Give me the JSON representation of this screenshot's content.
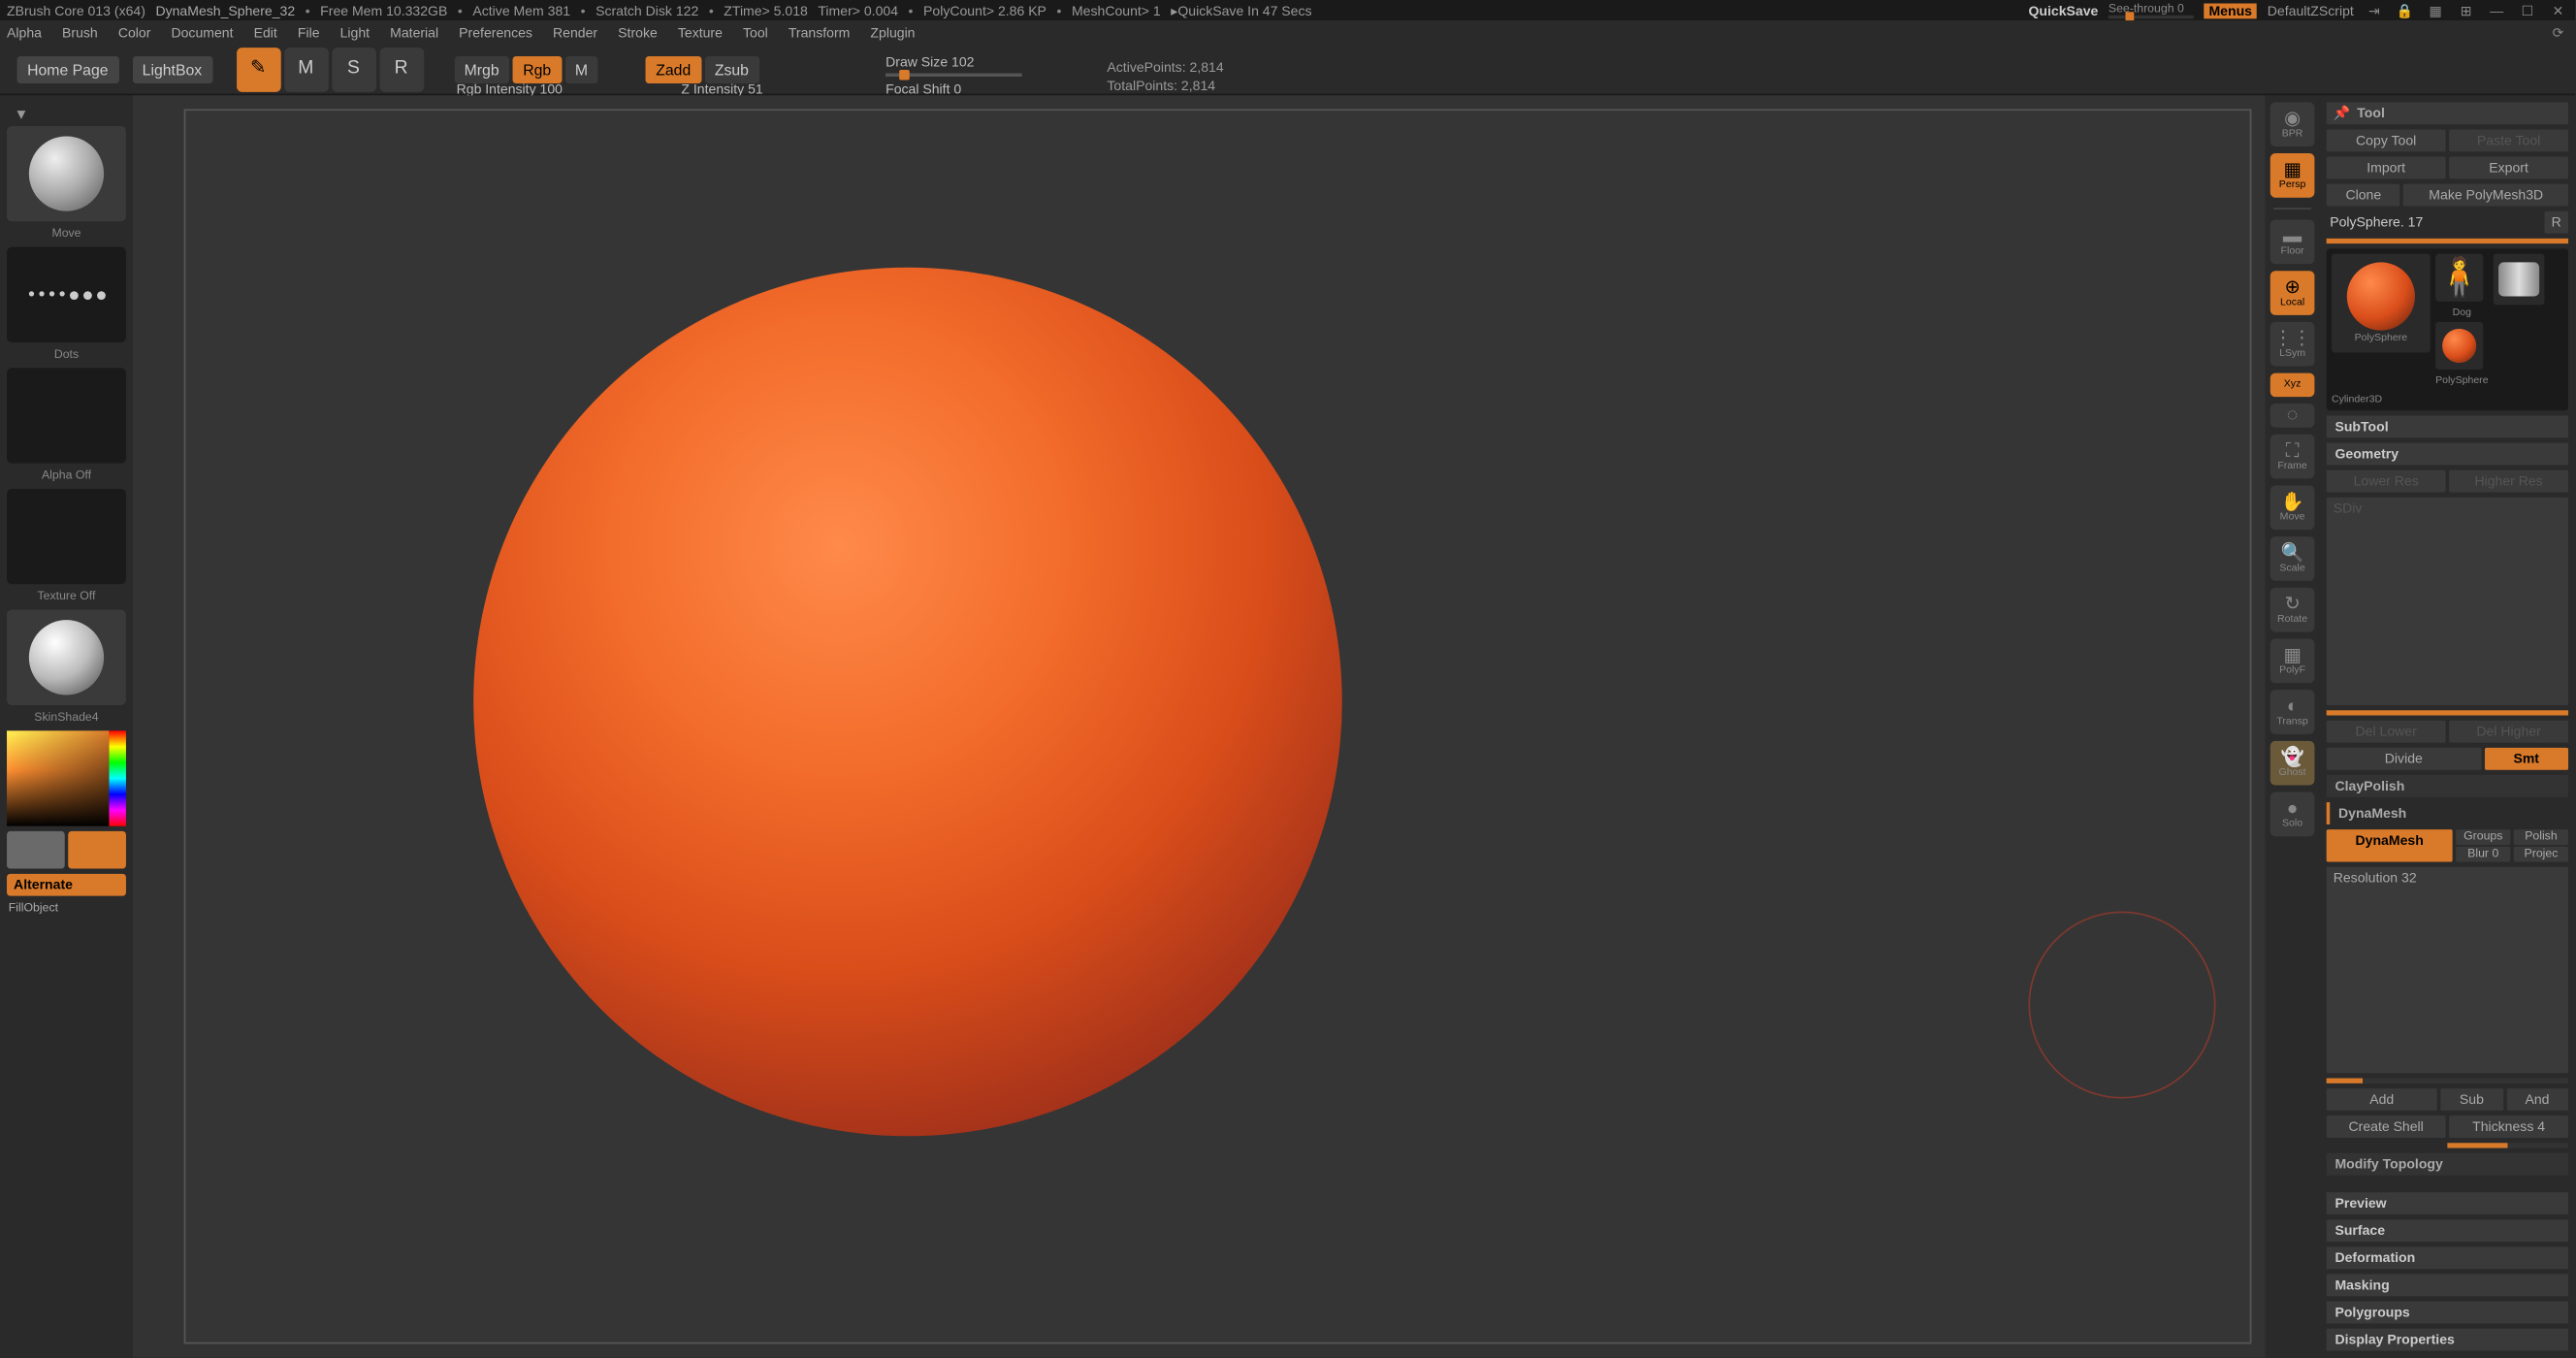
{
  "titlebar": {
    "app": "ZBrush Core 013 (x64)",
    "document": "DynaMesh_Sphere_32",
    "free_mem": "Free Mem 10.332GB",
    "active_mem": "Active Mem 381",
    "scratch": "Scratch Disk 122",
    "ztime": "ZTime> 5.018",
    "timer": "Timer> 0.004",
    "polycount": "PolyCount> 2.86 KP",
    "meshcount": "MeshCount> 1",
    "quicksave_in": "QuickSave In 47 Secs",
    "quicksave_btn": "QuickSave",
    "seethrough": "See-through  0",
    "menus": "Menus",
    "default_zscript": "DefaultZScript"
  },
  "menubar": [
    "Alpha",
    "Brush",
    "Color",
    "Document",
    "Edit",
    "File",
    "Light",
    "Material",
    "Preferences",
    "Render",
    "Stroke",
    "Texture",
    "Tool",
    "Transform",
    "Zplugin"
  ],
  "toolbar": {
    "home": "Home Page",
    "lightbox": "LightBox",
    "mode_icons": [
      {
        "label": "Draw",
        "active": true
      },
      {
        "label": "Move",
        "active": false
      },
      {
        "label": "Scale",
        "active": false
      },
      {
        "label": "Rotate",
        "active": false
      }
    ],
    "mrgb": "Mrgb",
    "rgb": "Rgb",
    "m": "M",
    "zadd": "Zadd",
    "zsub": "Zsub",
    "rgb_intensity_label": "Rgb Intensity 100",
    "z_intensity_label": "Z Intensity 51",
    "draw_size_label": "Draw Size 102",
    "focal_shift_label": "Focal Shift 0",
    "active_points": "ActivePoints: 2,814",
    "total_points": "TotalPoints: 2,814"
  },
  "left": {
    "brush_label": "Move",
    "stroke_label": "Dots",
    "alpha_label": "Alpha Off",
    "texture_label": "Texture Off",
    "material_label": "SkinShade4",
    "swatch1": "#6a6a6a",
    "swatch2": "#d97a2a",
    "alternate": "Alternate",
    "fillobject": "FillObject"
  },
  "viewport_strip": [
    {
      "label": "BPR",
      "active": false
    },
    {
      "label": "Persp",
      "active": true
    },
    {
      "label": "",
      "divider": true
    },
    {
      "label": "Floor",
      "active": false
    },
    {
      "label": "Local",
      "active": true
    },
    {
      "label": "LSym",
      "active": false
    },
    {
      "label": "Xyz",
      "active": true
    },
    {
      "label": "",
      "small": true
    },
    {
      "label": "Frame",
      "active": false
    },
    {
      "label": "Move",
      "active": false
    },
    {
      "label": "Scale",
      "active": false
    },
    {
      "label": "Rotate",
      "active": false
    },
    {
      "label": "PolyF",
      "active": false
    },
    {
      "label": "Transp",
      "active": false
    },
    {
      "label": "Ghost",
      "active": false
    },
    {
      "label": "Solo",
      "active": false
    }
  ],
  "right": {
    "tool_title": "Tool",
    "copy_tool": "Copy Tool",
    "paste_tool": "Paste Tool",
    "import": "Import",
    "export": "Export",
    "clone": "Clone",
    "make_polymesh": "Make PolyMesh3D",
    "polysphere_header": "PolySphere. 17",
    "r_toggle": "R",
    "thumbs": [
      {
        "label": "PolySphere",
        "type": "sphere"
      },
      {
        "label": "Dog",
        "type": "man"
      },
      {
        "label": "PolySphere",
        "type": "sphere-small"
      },
      {
        "label": "Cylinder3D",
        "type": "cylinder"
      }
    ],
    "subtool": "SubTool",
    "geometry": "Geometry",
    "lower_res": "Lower Res",
    "higher_res": "Higher Res",
    "sdiv": "SDiv",
    "del_lower": "Del Lower",
    "del_higher": "Del Higher",
    "divide": "Divide",
    "smt": "Smt",
    "claypolish": "ClayPolish",
    "dynamesh_header": "DynaMesh",
    "dynamesh_btn": "DynaMesh",
    "groups": "Groups",
    "polish": "Polish",
    "blur": "Blur 0",
    "project": "Projec",
    "resolution": "Resolution 32",
    "add": "Add",
    "sub": "Sub",
    "and": "And",
    "create_shell": "Create Shell",
    "thickness": "Thickness 4",
    "modify_topology": "Modify Topology",
    "preview": "Preview",
    "surface": "Surface",
    "deformation": "Deformation",
    "masking": "Masking",
    "polygroups": "Polygroups",
    "display_props": "Display Properties"
  }
}
